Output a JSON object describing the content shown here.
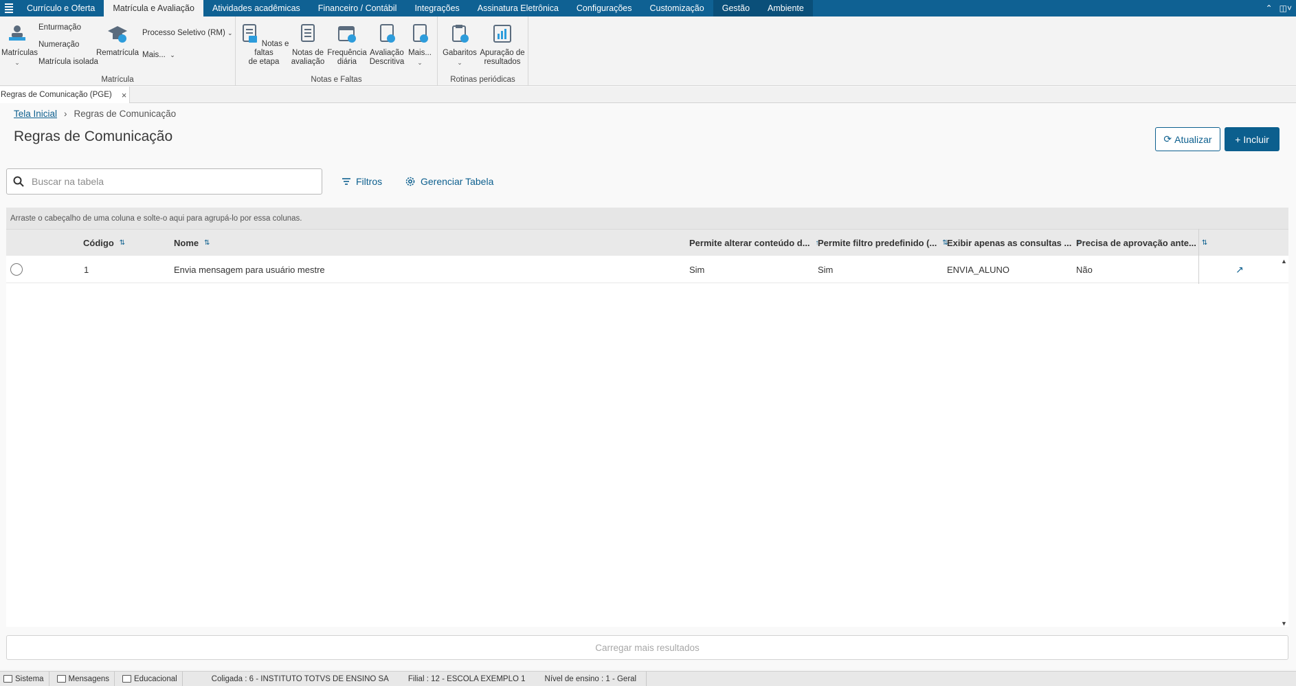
{
  "menu": {
    "app_icon": "menu-grid-icon",
    "tabs": [
      {
        "label": "Currículo e Oferta"
      },
      {
        "label": "Matrícula e Avaliação"
      },
      {
        "label": "Atividades acadêmicas"
      },
      {
        "label": "Financeiro / Contábil"
      },
      {
        "label": "Integrações"
      },
      {
        "label": "Assinatura Eletrônica"
      },
      {
        "label": "Configurações"
      },
      {
        "label": "Customização"
      },
      {
        "label": "Gestão"
      },
      {
        "label": "Ambiente"
      }
    ],
    "active_tab": "Matrícula e Avaliação"
  },
  "ribbon": {
    "matricula": {
      "label": "Matrícula",
      "matriculas": "Matrículas",
      "enturmacao": "Enturmação",
      "numeracao": "Numeração",
      "matricula_isolada": "Matrícula isolada",
      "rematricula": "Rematrícula",
      "processo_seletivo": "Processo Seletivo (RM)",
      "mais": "Mais..."
    },
    "notas": {
      "label": "Notas e Faltas",
      "notas_faltas_1": "Notas e faltas",
      "notas_faltas_2": "de etapa",
      "notas_avaliacao_1": "Notas de",
      "notas_avaliacao_2": "avaliação",
      "frequencia_1": "Frequência",
      "frequencia_2": "diária",
      "avaliacao_1": "Avaliação",
      "avaliacao_2": "Descritiva",
      "mais": "Mais..."
    },
    "rotinas": {
      "label": "Rotinas periódicas",
      "gabaritos": "Gabaritos",
      "apuracao_1": "Apuração de",
      "apuracao_2": "resultados"
    }
  },
  "doc_tab": {
    "label": "Regras de Comunicação (PGE)",
    "close": "×"
  },
  "breadcrumb": {
    "home": "Tela Inicial",
    "separator": "›",
    "current": "Regras de Comunicação"
  },
  "page": {
    "title": "Regras de Comunicação",
    "refresh_label": "Atualizar",
    "add_label": "Incluir"
  },
  "search": {
    "placeholder": "Buscar na tabela",
    "value": ""
  },
  "toolbar": {
    "filters": "Filtros",
    "manage_table": "Gerenciar Tabela"
  },
  "grid": {
    "group_hint": "Arraste o cabeçalho de uma coluna e solte-o aqui para agrupá-lo por essa colunas.",
    "columns": [
      "Código",
      "Nome",
      "Permite alterar conteúdo d...",
      "Permite filtro predefinido (...",
      "Exibir apenas as consultas ...",
      "Precisa de aprovação ante..."
    ],
    "rows": [
      {
        "codigo": "1",
        "nome": "Envia mensagem para usuário mestre",
        "permite_alterar": "Sim",
        "permite_filtro": "Sim",
        "exibir_consultas": "ENVIA_ALUNO",
        "precisa_aprovacao": "Não"
      }
    ],
    "load_more": "Carregar mais resultados"
  },
  "statusbar": {
    "sistema": "Sistema",
    "mensagens": "Mensagens",
    "educacional": "Educacional",
    "coligada": "Coligada : 6 - INSTITUTO TOTVS DE ENSINO SA",
    "filial": "Filial : 12 - ESCOLA EXEMPLO 1",
    "nivel": "Nível de ensino : 1 - Geral"
  },
  "colors": {
    "primary": "#0c5f8e",
    "menubar": "#0f6193"
  }
}
